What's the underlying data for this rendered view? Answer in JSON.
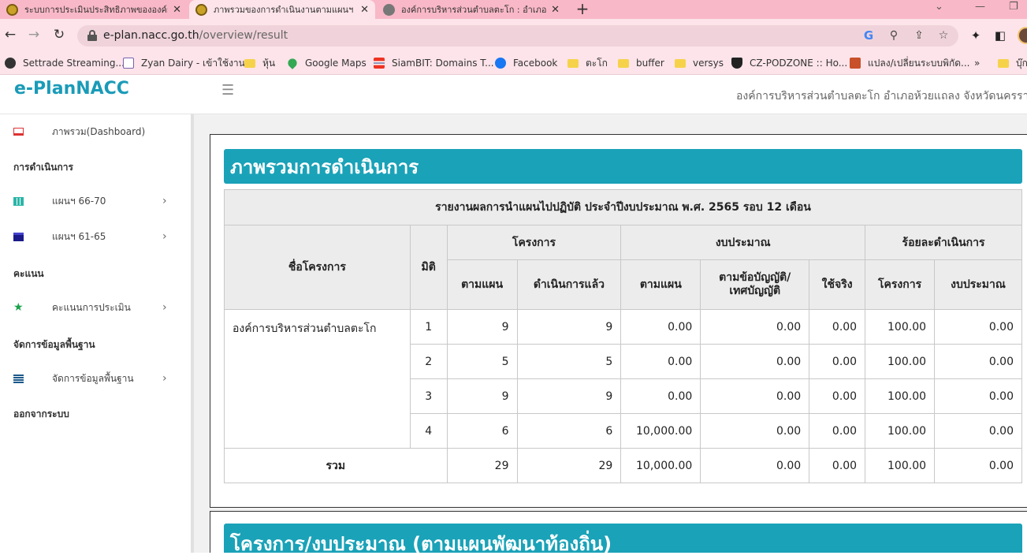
{
  "browser": {
    "tabs": [
      {
        "title": "ระบบการประเมินประสิทธิภาพขององค์กรฯ",
        "active": false
      },
      {
        "title": "ภาพรวมของการดำเนินงานตามแผนฯ",
        "active": true
      },
      {
        "title": "องค์การบริหารส่วนตำบลตะโก : อำเภอ",
        "active": false
      }
    ],
    "close_glyph": "✕",
    "new_tab_glyph": "+",
    "url_host": "e-plan.nacc.go.th",
    "url_path": "/overview/result",
    "bookmarks": [
      {
        "label": "Settrade Streaming...",
        "icon": "settrade-icon"
      },
      {
        "label": "Zyan Dairy - เข้าใช้งาน",
        "icon": "zyan-icon"
      },
      {
        "label": "หุ้น",
        "icon": "folder-icon"
      },
      {
        "label": "Google Maps",
        "icon": "maps-icon"
      },
      {
        "label": "SiamBIT: Domains T...",
        "icon": "siambit-icon"
      },
      {
        "label": "Facebook",
        "icon": "facebook-icon"
      },
      {
        "label": "ตะโก",
        "icon": "folder-icon"
      },
      {
        "label": "buffer",
        "icon": "folder-icon"
      },
      {
        "label": "versys",
        "icon": "folder-icon"
      },
      {
        "label": "CZ-PODZONE :: Ho...",
        "icon": "shield-icon"
      },
      {
        "label": "แปลง/เปลี่ยนระบบพิกัด...",
        "icon": "convert-icon"
      },
      {
        "label": "»",
        "icon": ""
      },
      {
        "label": "บุ๊ก",
        "icon": "folder-icon"
      }
    ]
  },
  "app": {
    "brand": "e-PlanNACC",
    "org_name": "องค์การบริหารส่วนตำบลตะโก อำเภอห้วยแถลง จังหวัดนครราชสี",
    "sidebar": {
      "dashboard": "ภาพรวม(Dashboard)",
      "section_operation": "การดำเนินการ",
      "plan_66_70": "แผนฯ 66-70",
      "plan_61_65": "แผนฯ 61-65",
      "section_score": "คะแนน",
      "assessment_score": "คะแนนการประเมิน",
      "section_base_data": "จัดการข้อมูลพื้นฐาน",
      "manage_base_data": "จัดการข้อมูลพื้นฐาน",
      "logout": "ออกจากระบบ"
    },
    "section1_title": "ภาพรวมการดำเนินการ",
    "section2_title": "โครงการ/งบประมาณ (ตามแผนพัฒนาท้องถิ่น)",
    "report": {
      "caption": "รายงานผลการนำแผนไปปฏิบัติ ประจำปีงบประมาณ พ.ศ. 2565 รอบ 12 เดือน",
      "headers": {
        "project_name": "ชื่อโครงการ",
        "dimension": "มิติ",
        "projects": "โครงการ",
        "budget": "งบประมาณ",
        "percent": "ร้อยละดำเนินการ",
        "planned": "ตามแผน",
        "done": "ดำเนินการแล้ว",
        "budget_planned": "ตามแผน",
        "budget_ordinance": "ตามข้อบัญญัติ/\nเทศบัญญัติ",
        "budget_actual": "ใช้จริง",
        "pct_projects": "โครงการ",
        "pct_budget": "งบประมาณ"
      },
      "org": "องค์การบริหารส่วนตำบลตะโก",
      "rows": [
        {
          "dim": "1",
          "planned": "9",
          "done": "9",
          "b_plan": "0.00",
          "b_ord": "0.00",
          "b_actual": "0.00",
          "p_proj": "100.00",
          "p_budget": "0.00"
        },
        {
          "dim": "2",
          "planned": "5",
          "done": "5",
          "b_plan": "0.00",
          "b_ord": "0.00",
          "b_actual": "0.00",
          "p_proj": "100.00",
          "p_budget": "0.00"
        },
        {
          "dim": "3",
          "planned": "9",
          "done": "9",
          "b_plan": "0.00",
          "b_ord": "0.00",
          "b_actual": "0.00",
          "p_proj": "100.00",
          "p_budget": "0.00"
        },
        {
          "dim": "4",
          "planned": "6",
          "done": "6",
          "b_plan": "10,000.00",
          "b_ord": "0.00",
          "b_actual": "0.00",
          "p_proj": "100.00",
          "p_budget": "0.00"
        }
      ],
      "total": {
        "label": "รวม",
        "planned": "29",
        "done": "29",
        "b_plan": "10,000.00",
        "b_ord": "0.00",
        "b_actual": "0.00",
        "p_proj": "100.00",
        "p_budget": "0.00"
      }
    }
  }
}
